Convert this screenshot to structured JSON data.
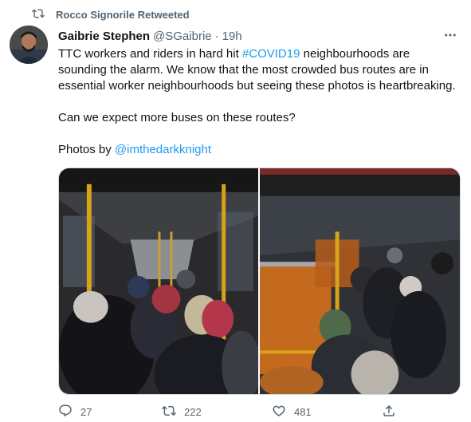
{
  "retweet_context": {
    "label": "Rocco Signorile Retweeted",
    "icon": "retweet-icon"
  },
  "author": {
    "name": "Gaibrie Stephen",
    "handle": "@SGaibrie",
    "separator": "·",
    "time": "19h"
  },
  "tweet": {
    "para1_prefix": "TTC workers and riders in hard hit ",
    "para1_hashtag": "#COVID19",
    "para1_suffix": " neighbourhoods are sounding the alarm. We know that the most crowded bus routes are in essential worker neighbourhoods but seeing these photos is heartbreaking.",
    "para2": "Can we expect more buses on these routes?",
    "para3_prefix": "Photos by ",
    "para3_mention": "@imthedarkknight"
  },
  "media": {
    "count": 2,
    "icons": [
      "crowded-bus-photo-1",
      "crowded-bus-photo-2"
    ]
  },
  "actions": {
    "reply_count": "27",
    "retweet_count": "222",
    "like_count": "481",
    "icons": [
      "reply-icon",
      "retweet-icon",
      "like-icon",
      "share-icon"
    ]
  },
  "colors": {
    "link": "#1d9bf0",
    "secondary_text": "#536471",
    "primary_text": "#0f1419"
  }
}
